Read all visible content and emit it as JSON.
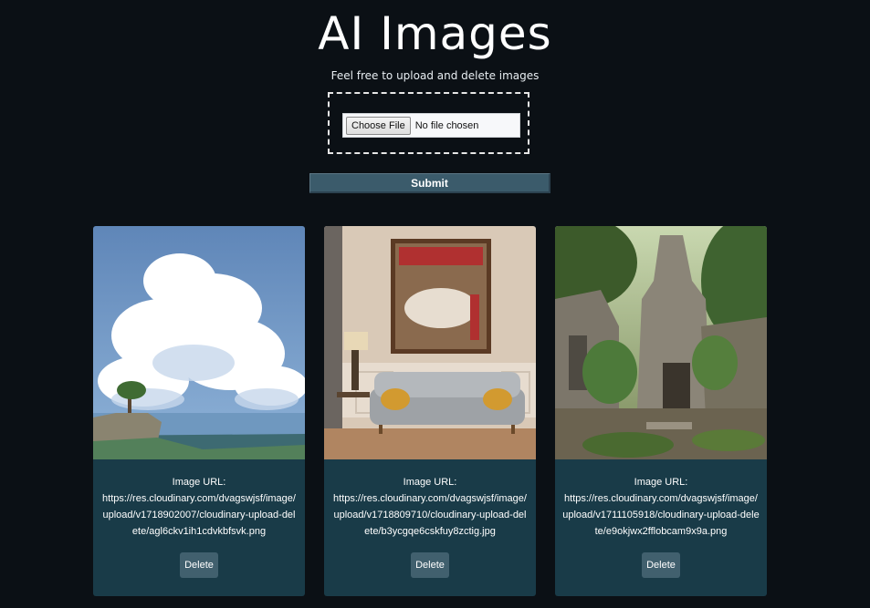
{
  "header": {
    "title": "AI Images",
    "subtitle": "Feel free to upload and delete images"
  },
  "upload": {
    "choose_label": "Choose File",
    "file_status": "No file chosen",
    "submit_label": "Submit"
  },
  "cards": [
    {
      "image_label": "Image URL:",
      "url": "https://res.cloudinary.com/dvagswjsf/image/upload/v1718902007/cloudinary-upload-delete/agl6ckv1ih1cdvkbfsvk.png",
      "delete_label": "Delete"
    },
    {
      "image_label": "Image URL:",
      "url": "https://res.cloudinary.com/dvagswjsf/image/upload/v1718809710/cloudinary-upload-delete/b3ycgqe6cskfuy8zctig.jpg",
      "delete_label": "Delete"
    },
    {
      "image_label": "Image URL:",
      "url": "https://res.cloudinary.com/dvagswjsf/image/upload/v1711105918/cloudinary-upload-delete/e9okjwx2fflobcam9x9a.png",
      "delete_label": "Delete"
    }
  ]
}
